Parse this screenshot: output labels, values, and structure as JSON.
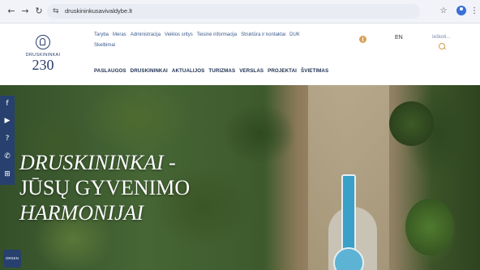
{
  "browser": {
    "url": "druskininkusavivaldybe.lt",
    "back_icon": "←",
    "forward_icon": "→",
    "reload_icon": "↻",
    "site_info_icon": "⇆",
    "star_icon": "☆",
    "menu_icon": "⋮"
  },
  "logo": {
    "name": "DRUSKININKAI",
    "number": "230"
  },
  "topnav": {
    "items": [
      "Taryba",
      "Meras",
      "Administracija",
      "Veiklos sritys",
      "Teisinė informacija",
      "Struktūra ir kontaktai",
      "DUK",
      "Skelbimai"
    ]
  },
  "header": {
    "language": "EN",
    "search_placeholder": "Ieškoti..."
  },
  "mainnav": {
    "items": [
      "PASLAUGOS",
      "DRUSKININKAI",
      "AKTUALIJOS",
      "TURIZMAS",
      "VERSLAS",
      "PROJEKTAI",
      "ŠVIETIMAS"
    ]
  },
  "hero": {
    "line1": "DRUSKININKAI -",
    "line2": "JŪSŲ GYVENIMO",
    "line3": "HARMONIJAI"
  },
  "social": {
    "facebook": "f",
    "youtube": "▶",
    "help": "?",
    "phone": "✆",
    "sitemap": "⊞",
    "badge": "DRSKN"
  },
  "colors": {
    "brand_navy": "#27406e",
    "accent_gold": "#d29a55"
  }
}
